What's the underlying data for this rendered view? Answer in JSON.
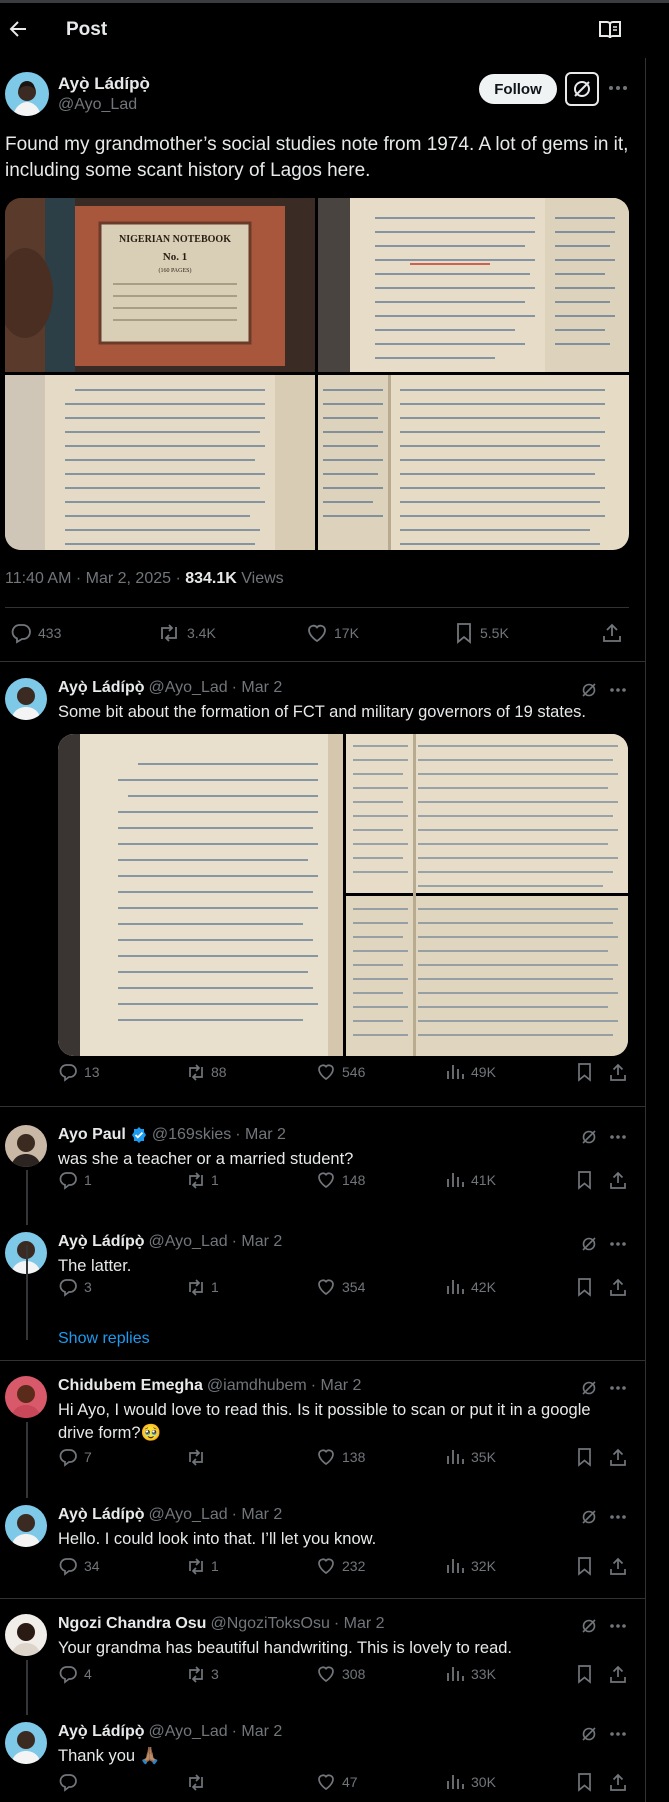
{
  "header": {
    "title": "Post"
  },
  "post": {
    "author_name": "Ayọ̀ Ládípọ̀",
    "author_handle": "@Ayo_Lad",
    "follow_label": "Follow",
    "text": "Found my grandmother’s social studies note from 1974. A lot of gems in it, including some scant history of Lagos here.",
    "time": "11:40 AM · Mar 2, 2025 · ",
    "views_value": "834.1K",
    "views_label": " Views",
    "notebook_cover": {
      "title": "NIGERIAN NOTEBOOK",
      "number": "No. 1",
      "pages": "(160 PAGES)"
    },
    "stats": {
      "replies": "433",
      "reposts": "3.4K",
      "likes": "17K",
      "bookmarks": "5.5K"
    }
  },
  "replies": [
    {
      "name": "Ayọ̀ Ládípọ̀",
      "handle": "@Ayo_Lad",
      "date": " · Mar 2",
      "text": "Some bit about the formation of FCT and military governors of 19 states.",
      "stats": {
        "replies": "13",
        "reposts": "88",
        "likes": "546",
        "views": "49K"
      }
    },
    {
      "name": "Ayo Paul",
      "handle": "@169skies",
      "date": " · Mar 2",
      "text": "was she a teacher or a married student?",
      "stats": {
        "replies": "1",
        "reposts": "1",
        "likes": "148",
        "views": "41K"
      }
    },
    {
      "name": "Ayọ̀ Ládípọ̀",
      "handle": "@Ayo_Lad",
      "date": " · Mar 2",
      "text": "The latter.",
      "stats": {
        "replies": "3",
        "reposts": "1",
        "likes": "354",
        "views": "42K"
      }
    },
    {
      "name": "Chidubem Emegha",
      "handle": "@iamdhubem",
      "date": " · Mar 2",
      "text": "Hi Ayo, I would love to read this. Is it possible to scan or put it in a google drive form?🥹",
      "stats": {
        "replies": "7",
        "reposts": "",
        "likes": "138",
        "views": "35K"
      }
    },
    {
      "name": "Ayọ̀ Ládípọ̀",
      "handle": "@Ayo_Lad",
      "date": " · Mar 2",
      "text": "Hello. I could look into that. I’ll let you know.",
      "stats": {
        "replies": "34",
        "reposts": "1",
        "likes": "232",
        "views": "32K"
      }
    },
    {
      "name": "Ngozi Chandra Osu",
      "handle": "@NgoziToksOsu",
      "date": " · Mar 2",
      "text": "Your grandma has beautiful handwriting. This is lovely to read.",
      "stats": {
        "replies": "4",
        "reposts": "3",
        "likes": "308",
        "views": "33K"
      }
    },
    {
      "name": "Ayọ̀ Ládípọ̀",
      "handle": "@Ayo_Lad",
      "date": " · Mar 2",
      "text": "Thank you 🙏🏽",
      "stats": {
        "replies": "",
        "reposts": "",
        "likes": "47",
        "views": "30K"
      }
    }
  ],
  "show_replies_label": "Show replies",
  "icons": {
    "back": "arrow-left-icon",
    "reader": "reader-mode-icon",
    "grok": "grok-icon",
    "more": "more-icon",
    "reply": "reply-icon",
    "repost": "repost-icon",
    "like": "like-icon",
    "views": "views-icon",
    "bookmark": "bookmark-icon",
    "share": "share-icon",
    "verified": "verified-badge-icon"
  },
  "colors": {
    "background": "#000000",
    "text": "#e7e9ea",
    "muted": "#71767b",
    "link": "#1d9bf0",
    "divider": "#2f3336"
  }
}
